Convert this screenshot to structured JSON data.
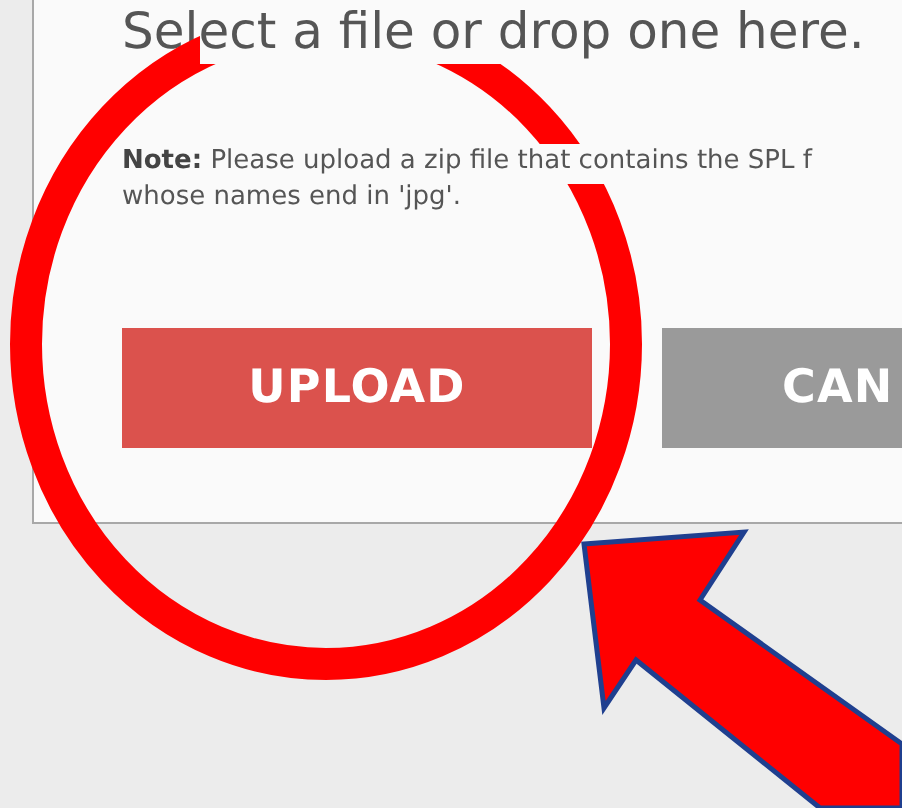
{
  "heading": "Select a file or drop one here.",
  "note": {
    "label": "Note:",
    "text": "Please upload a zip file that contains the SPL f",
    "text_line_2": "whose names end in 'jpg'."
  },
  "buttons": [
    {
      "label": "UPLOAD",
      "kind": "primary"
    },
    {
      "label": "CAN",
      "kind": "secondary"
    }
  ]
}
